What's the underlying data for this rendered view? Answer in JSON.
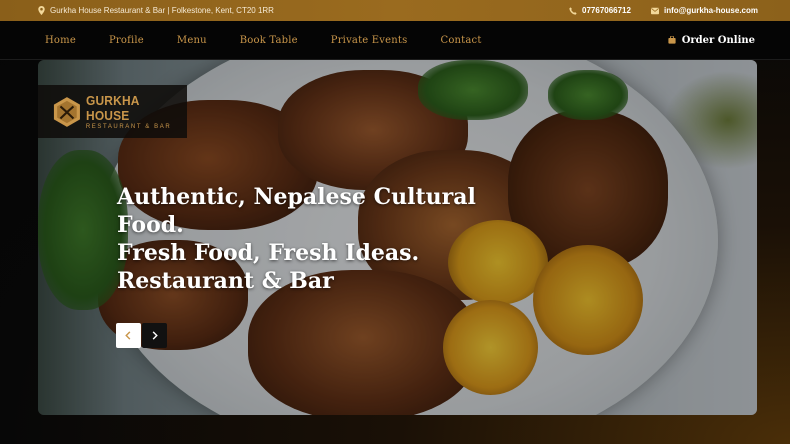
{
  "topbar": {
    "address": "Gurkha House Restaurant & Bar | Folkestone, Kent, CT20 1RR",
    "phone": "07767066712",
    "email": "info@gurkha-house.com"
  },
  "nav": {
    "items": [
      "Home",
      "Profile",
      "Menu",
      "Book Table",
      "Private Events",
      "Contact"
    ],
    "order_label": "Order Online"
  },
  "logo": {
    "name": "GURKHA HOUSE",
    "tagline": "RESTAURANT & BAR"
  },
  "hero": {
    "headline_lines": [
      "Authentic, Nepalese Cultural Food.",
      "Fresh Food, Fresh Ideas.",
      "Restaurant & Bar"
    ],
    "image": "grilled-chicken-with-charred-lemons"
  },
  "colors": {
    "accent": "#c9964a",
    "topbar": "#9a6b1f",
    "nav_bg": "#050505"
  },
  "icons": {
    "address": "map-pin-icon",
    "phone": "phone-icon",
    "email": "envelope-icon",
    "order": "shopping-bag-icon",
    "prev": "chevron-left-icon",
    "next": "chevron-right-icon"
  }
}
